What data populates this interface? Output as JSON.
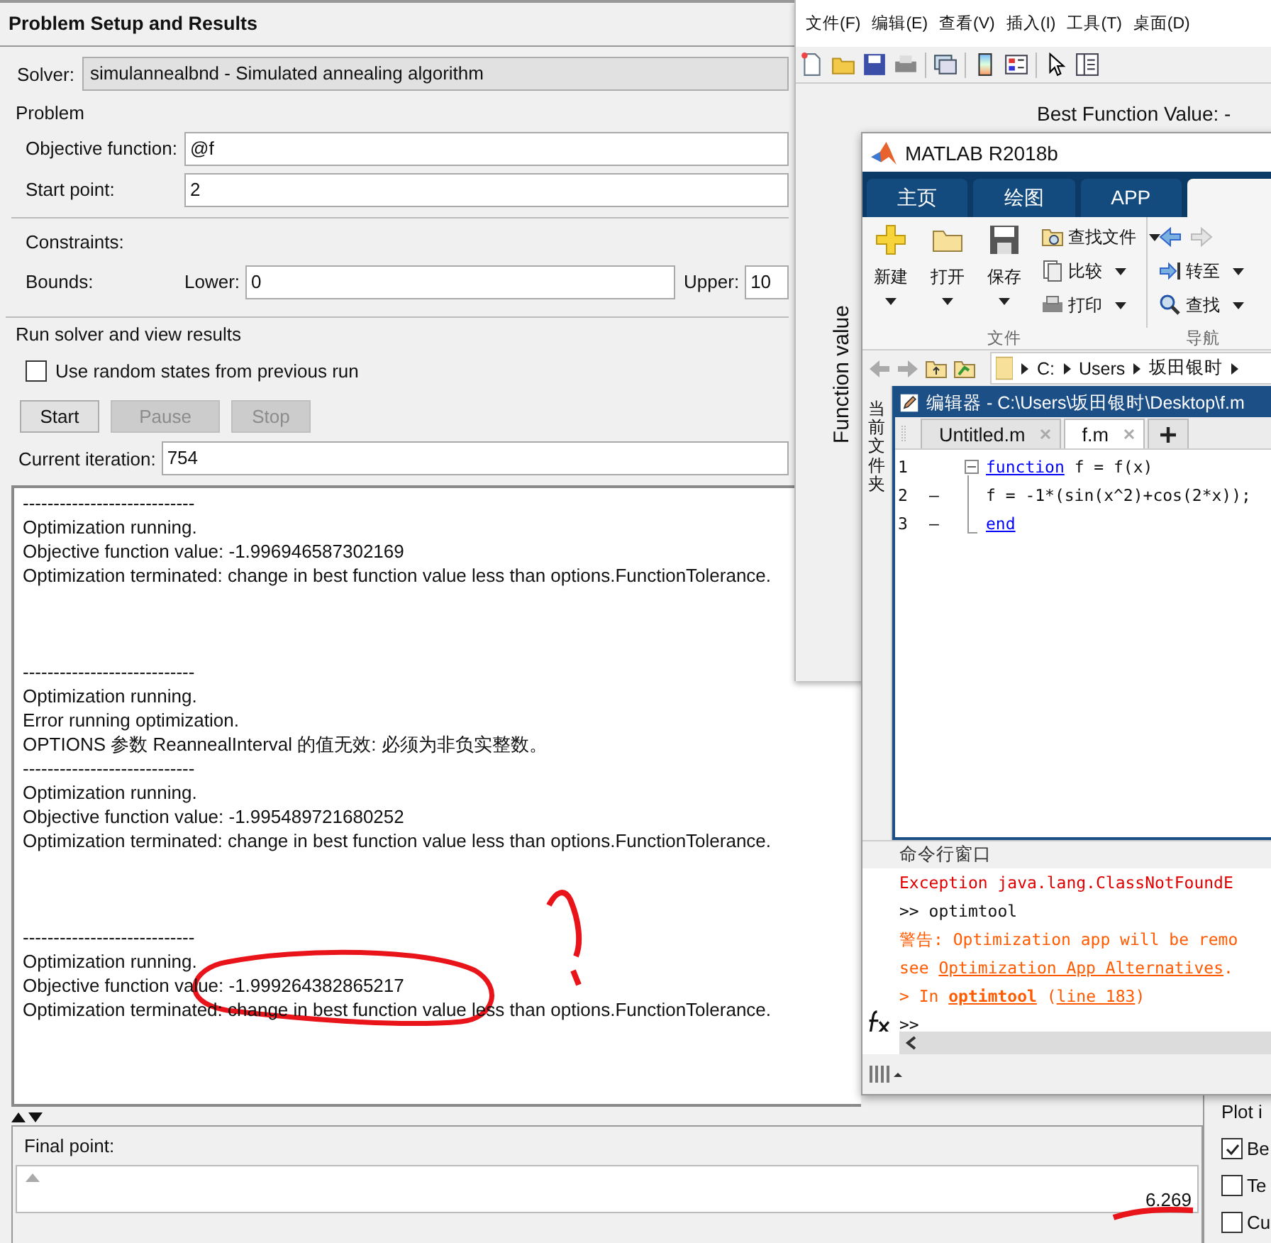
{
  "optim": {
    "title": "Problem Setup and Results",
    "solver": {
      "label": "Solver:",
      "value": "simulannealbnd - Simulated annealing algorithm"
    },
    "problem": {
      "legend": "Problem",
      "objective": {
        "label": "Objective function:",
        "value": "@f"
      },
      "start": {
        "label": "Start point:",
        "value": "2"
      }
    },
    "constraints": {
      "label": "Constraints:",
      "bounds_label": "Bounds:",
      "lower": {
        "label": "Lower:",
        "value": "0"
      },
      "upper": {
        "label": "Upper:",
        "value": "10"
      }
    },
    "run": {
      "legend": "Run solver and view results",
      "checkbox": {
        "label": "Use random states from previous run",
        "checked": false
      },
      "buttons": [
        {
          "label": "Start",
          "disabled": false
        },
        {
          "label": "Pause",
          "disabled": true
        },
        {
          "label": "Stop",
          "disabled": true
        }
      ],
      "iteration": {
        "label": "Current iteration:",
        "value": "754"
      }
    },
    "log": [
      {
        "lines": [
          "----------------------------",
          "Optimization running.",
          "Objective function value: -1.996946587302169",
          "Optimization terminated: change in best function value less than options.FunctionTolerance."
        ],
        "kind": "result"
      },
      {
        "lines": [
          "----------------------------",
          "Optimization running.",
          "Error running optimization.",
          "OPTIONS 参数 ReannealInterval 的值无效: 必须为非负实整数。"
        ],
        "kind": "error"
      },
      {
        "lines": [
          "----------------------------",
          "Optimization running.",
          "Objective function value: -1.995489721680252",
          "Optimization terminated: change in best function value less than options.FunctionTolerance."
        ],
        "kind": "result"
      },
      {
        "lines": [
          "----------------------------",
          "Optimization running.",
          "Objective function value: -1.999264382865217",
          "Optimization terminated: change in best function value less than options.FunctionTolerance."
        ],
        "kind": "result"
      }
    ],
    "final_point": {
      "label": "Final point:",
      "value": "6.269"
    },
    "plot_panel": {
      "title": "Plot i",
      "options": [
        {
          "label": "Be",
          "checked": true
        },
        {
          "label": "Te",
          "checked": false
        },
        {
          "label": "Cu",
          "checked": false
        }
      ]
    }
  },
  "figure": {
    "menu": [
      "文件(F)",
      "编辑(E)",
      "查看(V)",
      "插入(I)",
      "工具(T)",
      "桌面(D)"
    ],
    "plot_title": "Best Function Value: -",
    "ylabel": "Function value"
  },
  "matlab": {
    "title": "MATLAB R2018b",
    "tabs": [
      {
        "label": "主页",
        "selected": false
      },
      {
        "label": "绘图",
        "selected": false
      },
      {
        "label": "APP",
        "selected": false
      },
      {
        "selected": true
      }
    ],
    "big_buttons": [
      "新建",
      "打开",
      "保存"
    ],
    "file_actions": [
      "查找文件",
      "比较",
      "打印"
    ],
    "nav_actions": [
      "转至",
      "查找"
    ],
    "groups": [
      "文件",
      "导航"
    ],
    "path": [
      "C:",
      "Users",
      "坂田银时"
    ],
    "side_panel": "当前文件夹",
    "editor": {
      "title": "编辑器 - C:\\Users\\坂田银时\\Desktop\\f.m",
      "tabs": [
        {
          "label": "Untitled.m",
          "selected": false
        },
        {
          "label": "f.m",
          "selected": true
        }
      ],
      "lines": [
        {
          "number": "1",
          "segments": [
            {
              "kind": "keyword",
              "text": "function"
            },
            {
              "kind": "plain",
              "text": " f = f(x)"
            }
          ]
        },
        {
          "number": "2",
          "marker": "—",
          "segments": [
            {
              "kind": "plain",
              "text": "f = -1*(sin(x^2)+cos(2*x));"
            }
          ]
        },
        {
          "number": "3",
          "marker": "—",
          "segments": [
            {
              "kind": "keyword",
              "text": "end"
            }
          ]
        }
      ]
    },
    "command": {
      "title": "命令行窗口",
      "lines": [
        {
          "current": false,
          "segments": [
            {
              "kind": "error",
              "text": "Exception  java.lang.ClassNotFoundE"
            }
          ]
        },
        {
          "current": false,
          "segments": [
            {
              "kind": "plain",
              "text": ">> optimtool"
            }
          ]
        },
        {
          "current": false,
          "segments": [
            {
              "kind": "warn",
              "text": "警告: Optimization app will be remo"
            }
          ]
        },
        {
          "current": false,
          "segments": [
            {
              "kind": "warn",
              "text": "see "
            },
            {
              "kind": "link",
              "text": "Optimization App Alternatives"
            },
            {
              "kind": "warn",
              "text": "."
            }
          ]
        },
        {
          "current": false,
          "segments": [
            {
              "kind": "warn",
              "text": "> In "
            },
            {
              "kind": "boldlink",
              "text": "optimtool"
            },
            {
              "kind": "warn",
              "text": " ("
            },
            {
              "kind": "link",
              "text": "line 183"
            },
            {
              "kind": "warn",
              "text": ")"
            }
          ]
        },
        {
          "current": true,
          "segments": [
            {
              "kind": "plain",
              "text": ">>"
            }
          ]
        }
      ]
    }
  }
}
